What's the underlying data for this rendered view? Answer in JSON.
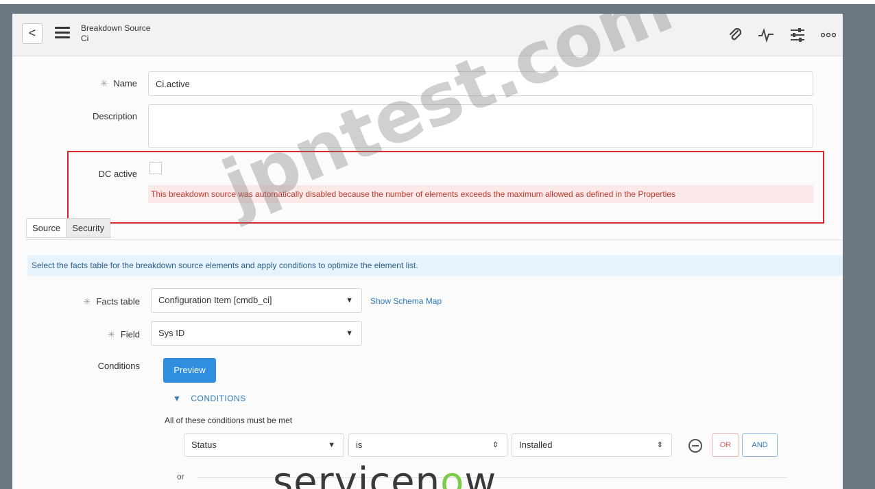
{
  "header": {
    "title": "Breakdown Source",
    "subtitle": "Ci",
    "back_glyph": "<",
    "icons": [
      "paperclip-icon",
      "activity-icon",
      "settings-sliders-icon",
      "more-icon"
    ]
  },
  "form": {
    "name_label": "Name",
    "name_value": "Ci.active",
    "description_label": "Description",
    "description_value": "",
    "dc_active_label": "DC active",
    "dc_active_checked": false,
    "warning": "This breakdown source was automatically disabled because the number of elements exceeds the maximum allowed as defined in the Properties"
  },
  "tabs": [
    {
      "label": "Source",
      "active": true
    },
    {
      "label": "Security",
      "active": false
    }
  ],
  "source": {
    "info": "Select the facts table for the breakdown source elements and apply conditions to optimize the element list.",
    "facts_table_label": "Facts table",
    "facts_table_value": "Configuration Item [cmdb_ci]",
    "schema_link": "Show Schema Map",
    "field_label": "Field",
    "field_value": "Sys ID",
    "conditions_label": "Conditions",
    "preview_label": "Preview",
    "conditions_toggle": "CONDITIONS",
    "conditions_note": "All of these conditions must be met",
    "condition_row": {
      "field": "Status",
      "operator": "is",
      "value": "Installed"
    },
    "or_label": "OR",
    "and_label": "AND",
    "or_divider": "or"
  },
  "watermark": {
    "text": "jpntest.com",
    "brand_pre": "servicen",
    "brand_o": "o",
    "brand_post": "w"
  },
  "colors": {
    "warning_text": "#c0392b",
    "highlight": "#d9262b",
    "primary": "#2f8fde",
    "link": "#2d7bb8"
  }
}
